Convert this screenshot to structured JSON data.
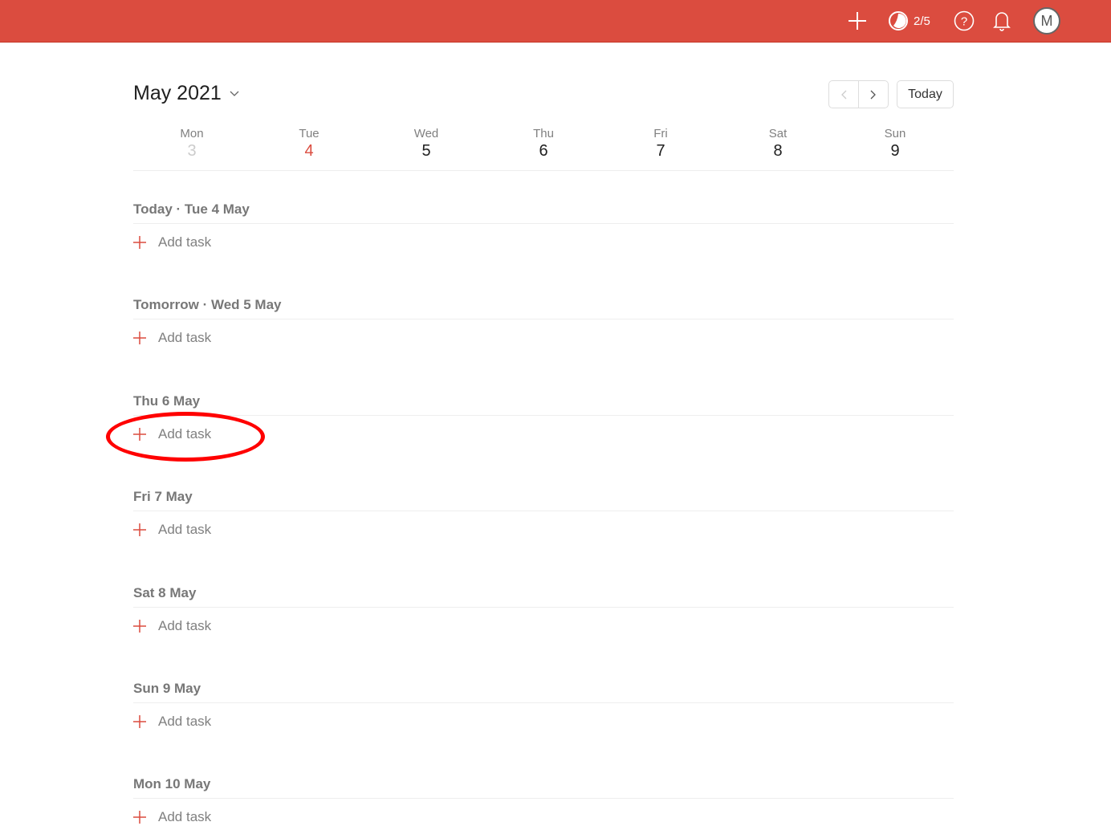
{
  "topbar": {
    "karma": "2/5",
    "avatar_initial": "M",
    "color": "#db4c3f"
  },
  "calendar": {
    "month": "May 2021",
    "today_label": "Today",
    "days": [
      {
        "name": "Mon",
        "num": "3"
      },
      {
        "name": "Tue",
        "num": "4"
      },
      {
        "name": "Wed",
        "num": "5"
      },
      {
        "name": "Thu",
        "num": "6"
      },
      {
        "name": "Fri",
        "num": "7"
      },
      {
        "name": "Sat",
        "num": "8"
      },
      {
        "name": "Sun",
        "num": "9"
      }
    ]
  },
  "sections": [
    {
      "title": "Today · Tue 4 May",
      "add": "Add task"
    },
    {
      "title": "Tomorrow · Wed 5 May",
      "add": "Add task"
    },
    {
      "title": "Thu 6 May",
      "add": "Add task"
    },
    {
      "title": "Fri 7 May",
      "add": "Add task"
    },
    {
      "title": "Sat 8 May",
      "add": "Add task"
    },
    {
      "title": "Sun 9 May",
      "add": "Add task"
    },
    {
      "title": "Mon 10 May",
      "add": "Add task"
    }
  ]
}
